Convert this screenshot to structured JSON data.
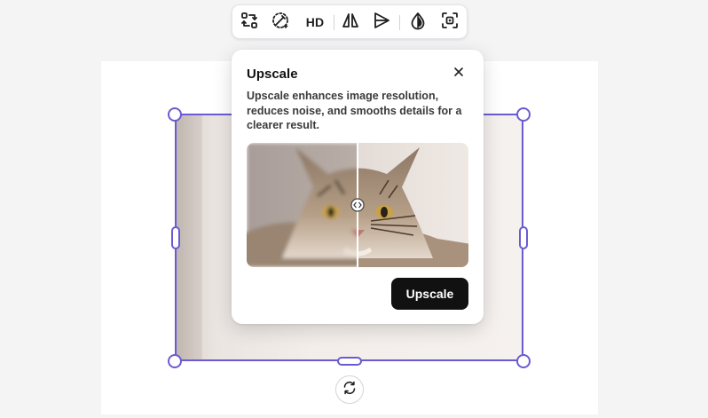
{
  "toolbar": {
    "tools": [
      {
        "icon": "swap-arrows-icon",
        "label": ""
      },
      {
        "icon": "magic-wand-icon",
        "label": ""
      },
      {
        "icon": "hd-icon",
        "label": "HD"
      },
      {
        "icon": "flip-horizontal-icon",
        "label": ""
      },
      {
        "icon": "flip-vertical-icon",
        "label": ""
      },
      {
        "icon": "opacity-drop-icon",
        "label": ""
      },
      {
        "icon": "select-region-icon",
        "label": ""
      }
    ]
  },
  "popover": {
    "title": "Upscale",
    "description": "Upscale enhances image resolution, reduces noise, and smooths details for a clearer result.",
    "close_icon": "close-icon",
    "compare_handle_icon": "compare-slider-icon",
    "action_label": "Upscale"
  },
  "canvas": {
    "rotate_icon": "rotate-icon"
  },
  "colors": {
    "selection": "#6b5bd2",
    "primary_button": "#111111",
    "canvas_background": "#f4f4f5"
  }
}
